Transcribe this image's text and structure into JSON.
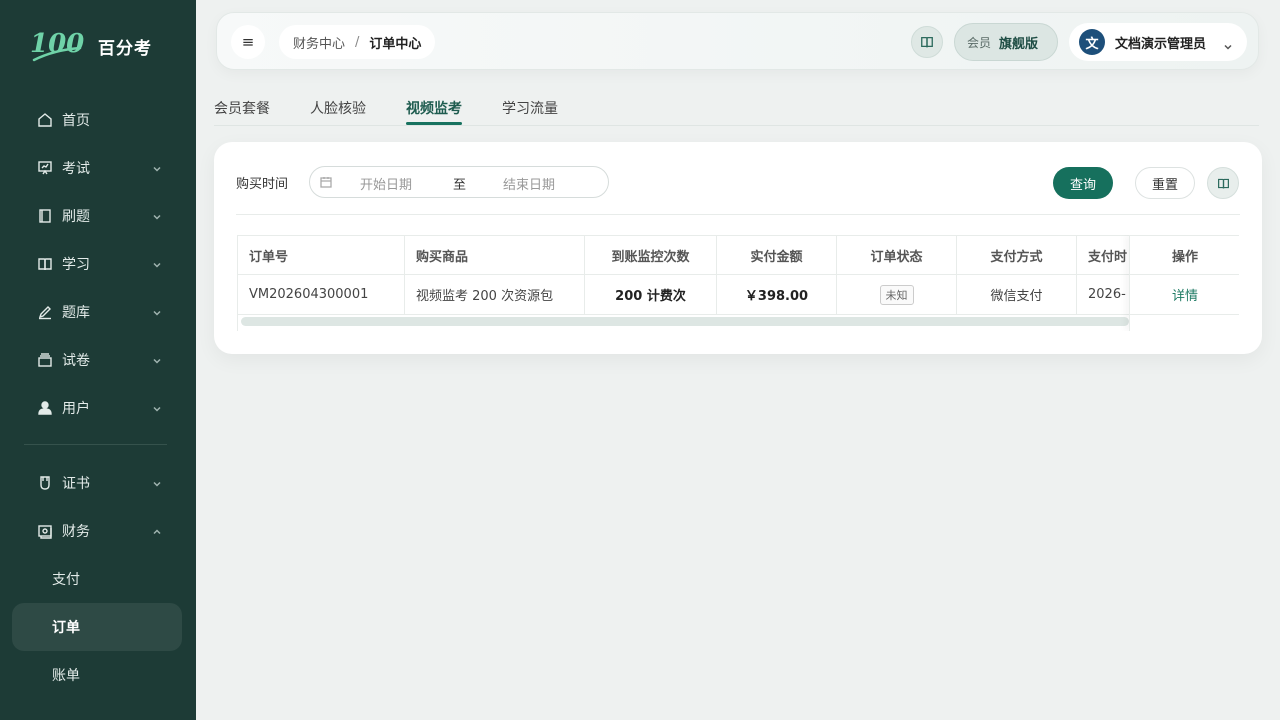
{
  "brand": {
    "logo_text": "百分考"
  },
  "sidebar": {
    "items": [
      {
        "label": "首页",
        "icon": "home-icon",
        "has_chevron": false
      },
      {
        "label": "考试",
        "icon": "presentation-icon",
        "has_chevron": true
      },
      {
        "label": "刷题",
        "icon": "notebook-icon",
        "has_chevron": true
      },
      {
        "label": "学习",
        "icon": "book-icon",
        "has_chevron": true
      },
      {
        "label": "题库",
        "icon": "pen-icon",
        "has_chevron": true
      },
      {
        "label": "试卷",
        "icon": "stack-icon",
        "has_chevron": true
      },
      {
        "label": "用户",
        "icon": "user-icon",
        "has_chevron": true
      },
      {
        "label": "证书",
        "icon": "badge-icon",
        "has_chevron": true
      },
      {
        "label": "财务",
        "icon": "wallet-icon",
        "has_chevron": true,
        "expanded": true
      }
    ],
    "sub_items": [
      {
        "label": "支付"
      },
      {
        "label": "订单",
        "active": true
      },
      {
        "label": "账单"
      }
    ]
  },
  "header": {
    "breadcrumb": [
      "财务中心",
      "订单中心"
    ],
    "breadcrumb_sep": "/",
    "member_label": "会员",
    "member_value": "旗舰版",
    "avatar_letter": "文",
    "user_name": "文档演示管理员"
  },
  "tabs": [
    "会员套餐",
    "人脸核验",
    "视频监考",
    "学习流量"
  ],
  "active_tab": "视频监考",
  "filter": {
    "label": "购买时间",
    "start_placeholder": "开始日期",
    "range_sep": "至",
    "end_placeholder": "结束日期",
    "query_label": "查询",
    "reset_label": "重置"
  },
  "table": {
    "columns": [
      "订单号",
      "购买商品",
      "到账监控次数",
      "实付金额",
      "订单状态",
      "支付方式",
      "支付时",
      "操作"
    ],
    "rows": [
      {
        "order_no": "VM202604300001",
        "product": "视频监考 200 次资源包",
        "credits": "200 计费次",
        "amount": "￥398.00",
        "status": "未知",
        "pay_method": "微信支付",
        "pay_time": "2026-",
        "action": "详情"
      }
    ]
  },
  "colors": {
    "sidebar_bg": "#1d3b36",
    "accent": "#16705d"
  }
}
